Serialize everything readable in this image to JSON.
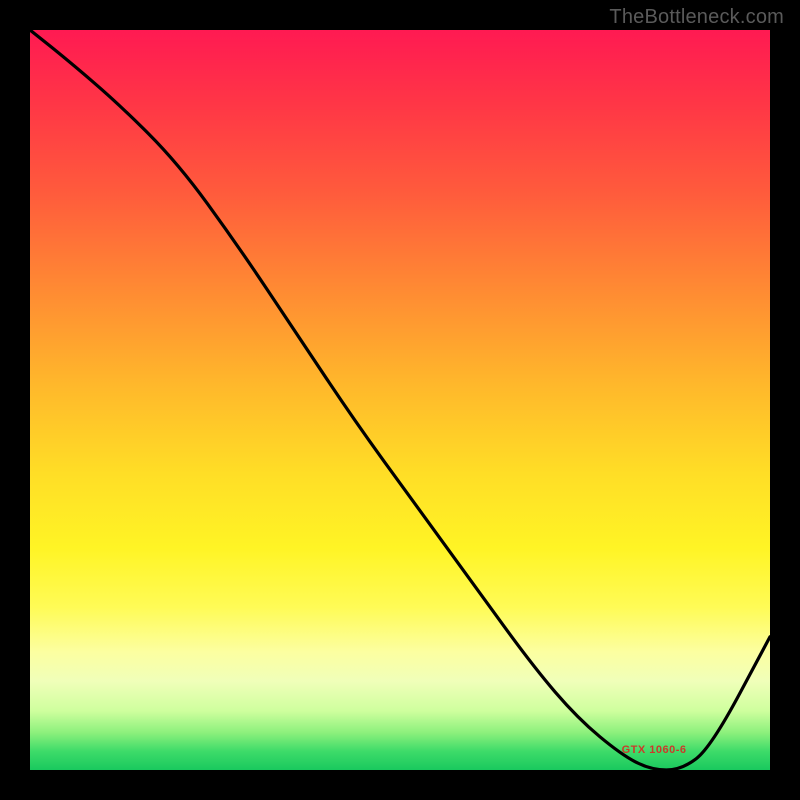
{
  "attribution": "TheBottleneck.com",
  "chart_data": {
    "type": "line",
    "title": "",
    "xlabel": "",
    "ylabel": "",
    "xlim": [
      0,
      100
    ],
    "ylim": [
      0,
      100
    ],
    "x": [
      0,
      5,
      12,
      20,
      28,
      36,
      44,
      52,
      60,
      68,
      74,
      80,
      84,
      88,
      92,
      100
    ],
    "values": [
      100,
      96,
      90,
      82,
      71,
      59,
      47,
      36,
      25,
      14,
      7,
      2,
      0,
      0,
      3,
      18
    ],
    "annotation": {
      "x": 84,
      "y": 0,
      "text": "GTX 1060-6"
    },
    "background_gradient": {
      "top": "#ff1a52",
      "mid": "#ffde26",
      "bottom": "#19c95e"
    }
  }
}
